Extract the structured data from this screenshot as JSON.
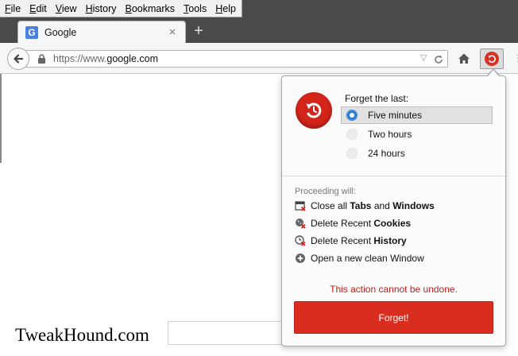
{
  "menubar": {
    "items": [
      {
        "label": "File",
        "key": "F",
        "rest": "ile"
      },
      {
        "label": "Edit",
        "key": "E",
        "rest": "dit"
      },
      {
        "label": "View",
        "key": "V",
        "rest": "iew"
      },
      {
        "label": "History",
        "key": "H",
        "rest": "istory"
      },
      {
        "label": "Bookmarks",
        "key": "B",
        "rest": "ookmarks"
      },
      {
        "label": "Tools",
        "key": "T",
        "rest": "ools"
      },
      {
        "label": "Help",
        "key": "H",
        "rest": "elp"
      }
    ]
  },
  "tab": {
    "title": "Google",
    "favicon": "G",
    "close": "×"
  },
  "newtab": "+",
  "urlbar": {
    "scheme": "https://www.",
    "host": "google.com",
    "dropdown": "▽",
    "reload": "C"
  },
  "panel": {
    "forget_label": "Forget the last:",
    "options": [
      {
        "label": "Five minutes",
        "selected": true
      },
      {
        "label": "Two hours",
        "selected": false
      },
      {
        "label": "24 hours",
        "selected": false
      }
    ],
    "proceeding_label": "Proceeding will:",
    "actions": [
      {
        "icon": "window-x-icon",
        "pre": "Close all ",
        "b1": "Tabs",
        "mid": " and ",
        "b2": "Windows"
      },
      {
        "icon": "cookie-x-icon",
        "pre": "Delete Recent ",
        "b1": "Cookies",
        "mid": "",
        "b2": ""
      },
      {
        "icon": "clock-x-icon",
        "pre": "Delete Recent ",
        "b1": "History",
        "mid": "",
        "b2": ""
      },
      {
        "icon": "plus-circle-icon",
        "pre": "Open a new clean Window",
        "b1": "",
        "mid": "",
        "b2": ""
      }
    ],
    "warning": "This action cannot be undone.",
    "forget_button": "Forget!"
  },
  "page": {
    "watermark": "TweakHound.com"
  },
  "colors": {
    "accent_red": "#d92d20",
    "warning_red": "#c0211a",
    "radio_blue": "#2f7fd6"
  }
}
